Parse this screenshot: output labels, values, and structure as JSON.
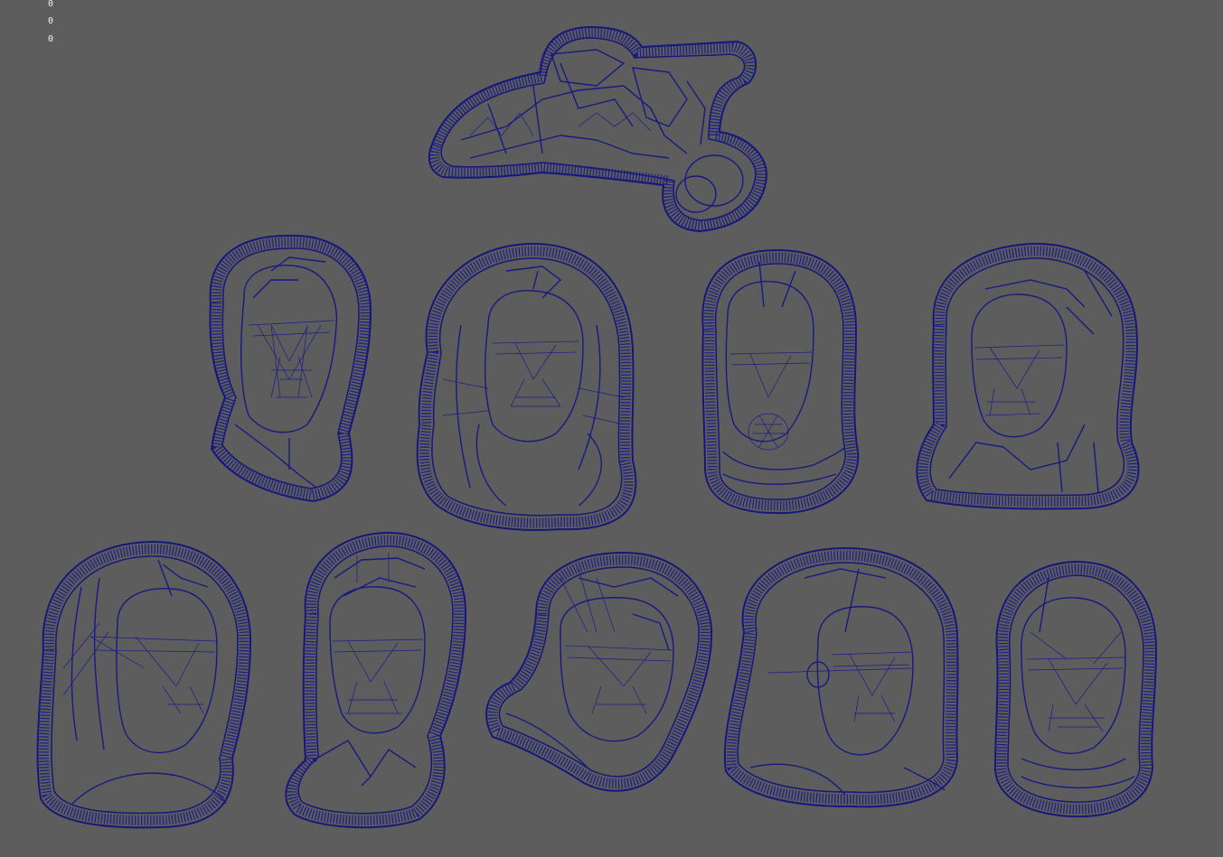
{
  "hud": {
    "line1": "0",
    "line2": "0",
    "line3": "0"
  },
  "colors": {
    "background": "#5d5d5d",
    "wireframe": "#16177a",
    "hud_text": "#f2f2f2"
  },
  "models": [
    {
      "id": "ship",
      "kind": "spaceship"
    },
    {
      "id": "bust-1",
      "kind": "portrait"
    },
    {
      "id": "bust-2",
      "kind": "portrait"
    },
    {
      "id": "bust-3",
      "kind": "portrait"
    },
    {
      "id": "bust-4",
      "kind": "portrait"
    },
    {
      "id": "bust-5",
      "kind": "portrait"
    },
    {
      "id": "bust-6",
      "kind": "portrait"
    },
    {
      "id": "bust-7",
      "kind": "portrait"
    },
    {
      "id": "bust-8",
      "kind": "portrait"
    },
    {
      "id": "bust-9",
      "kind": "portrait"
    }
  ]
}
